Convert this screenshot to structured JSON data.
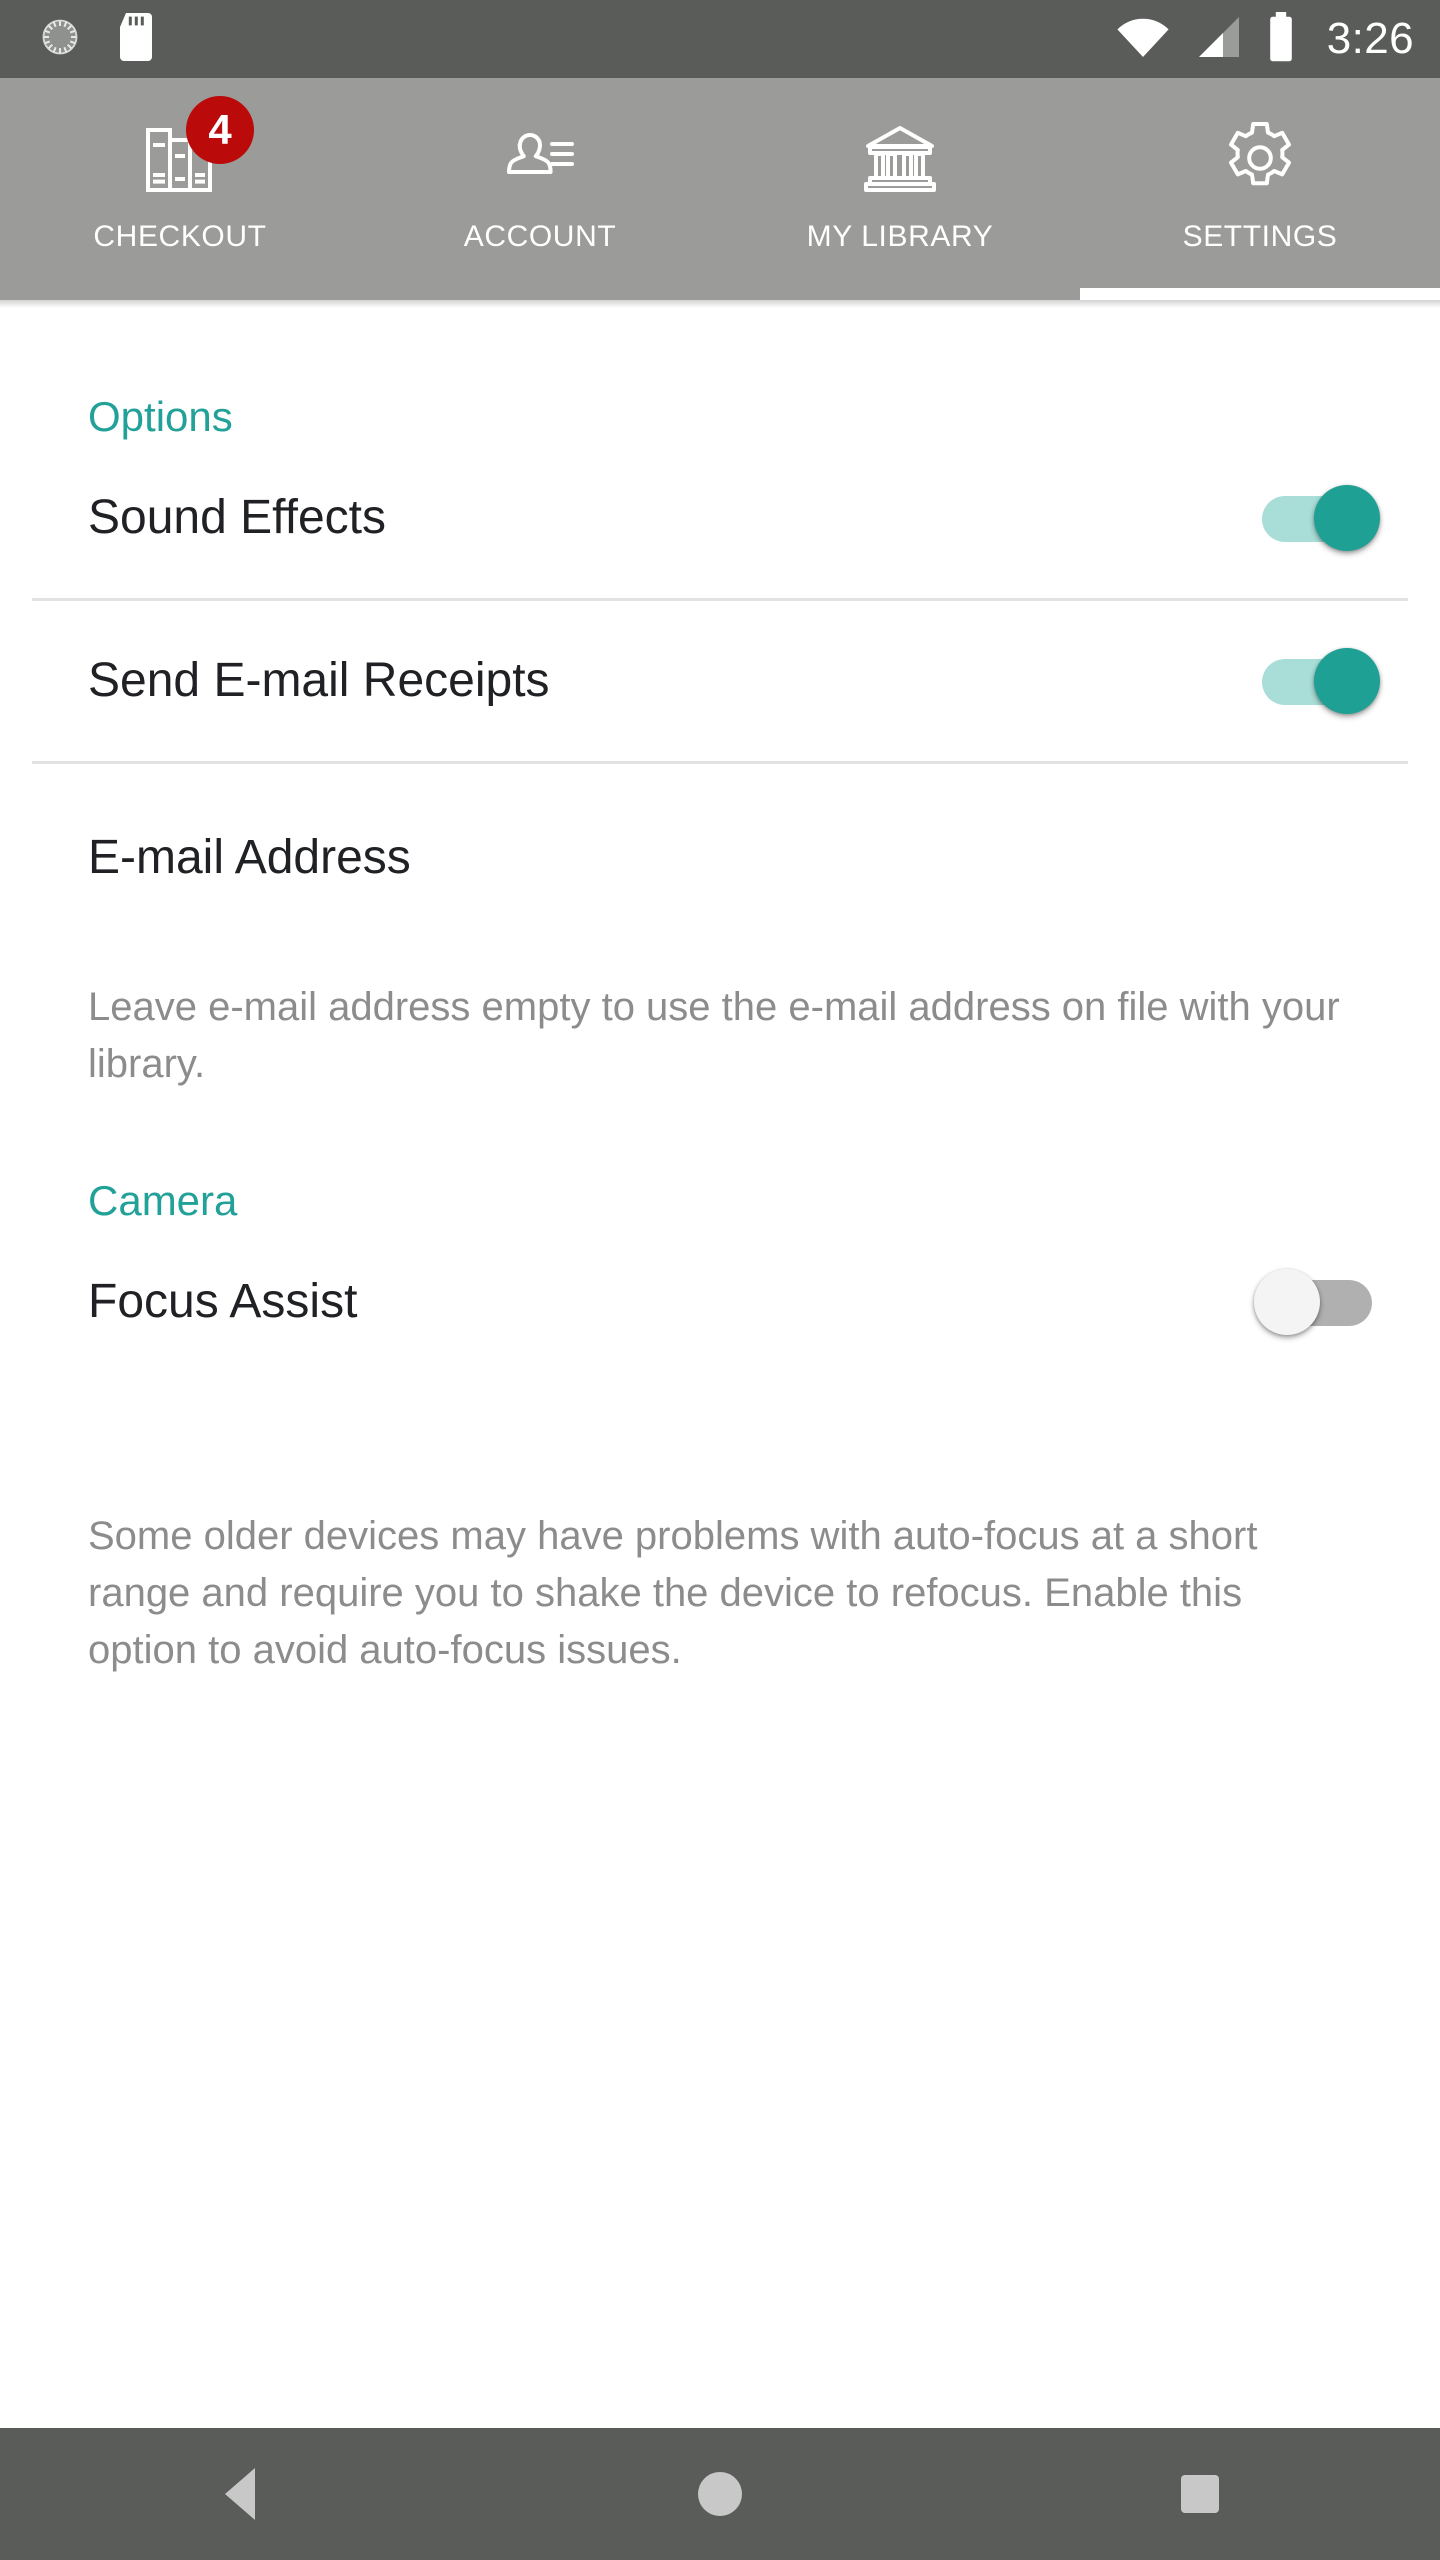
{
  "status_bar": {
    "time": "3:26",
    "left_icons": [
      "brightness-dial-icon",
      "sd-card-icon"
    ],
    "right_icons": [
      "wifi-icon",
      "cellular-signal-icon",
      "battery-icon"
    ],
    "background": "#5a5c59"
  },
  "tabs": {
    "active_index": 3,
    "background": "#9b9c99",
    "items": [
      {
        "label": "CHECKOUT",
        "icon": "books-icon",
        "badge": "4"
      },
      {
        "label": "ACCOUNT",
        "icon": "person-card-icon",
        "badge": ""
      },
      {
        "label": "MY LIBRARY",
        "icon": "library-building-icon",
        "badge": ""
      },
      {
        "label": "SETTINGS",
        "icon": "gear-icon",
        "badge": ""
      }
    ],
    "badge_color": "#bb0a0a"
  },
  "settings": {
    "accent_color": "#22a198",
    "sections": [
      {
        "header": "Options",
        "rows": [
          {
            "title": "Sound Effects",
            "switch_state": "on"
          },
          {
            "title": "Send E-mail Receipts",
            "switch_state": "on"
          }
        ],
        "field": {
          "label": "E-mail Address",
          "value": "",
          "placeholder": "E-mail Address"
        },
        "help": "Leave e-mail address empty to use the e-mail address on file with your library."
      },
      {
        "header": "Camera",
        "rows": [
          {
            "title": "Focus Assist",
            "switch_state": "off"
          }
        ],
        "help": "Some older devices may have problems with auto-focus at a short range and require you to shake the device to refocus. Enable this option to avoid auto-focus issues."
      }
    ]
  },
  "nav_bar": {
    "background": "#5a5c59",
    "buttons": [
      {
        "name": "back",
        "icon": "back-triangle-icon"
      },
      {
        "name": "home",
        "icon": "home-circle-icon"
      },
      {
        "name": "recents",
        "icon": "recents-square-icon"
      }
    ]
  }
}
